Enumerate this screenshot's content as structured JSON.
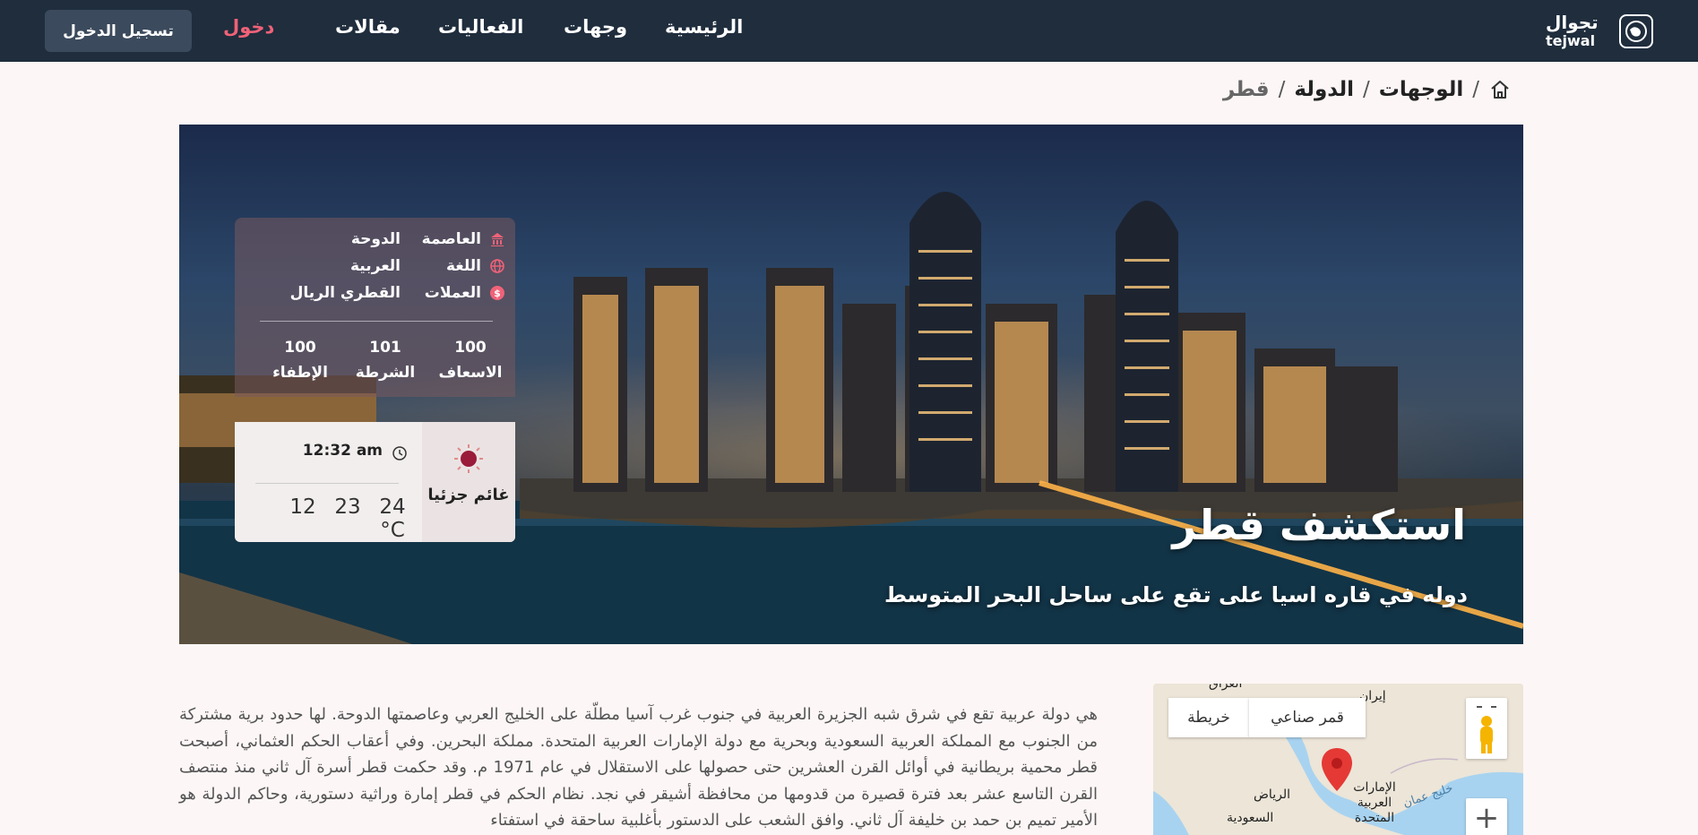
{
  "nav": {
    "logo_text": "تجوال",
    "logo_sub": "tejwal",
    "links": [
      "الرئيسية",
      "وجهات",
      "الفعاليات",
      "مقالات"
    ],
    "login": "دخول",
    "signup": "تسجيل الدخول"
  },
  "breadcrumb": [
    "الوجهات",
    "الدولة",
    "قطر"
  ],
  "hero": {
    "title": "استكشف قطر",
    "subtitle": "دوله في قاره اسيا على تقع على ساحل البحر المتوسط"
  },
  "info": {
    "capital_label": "العاصمة",
    "capital_value": "الدوحة",
    "language_label": "اللغة",
    "language_value": "العربية",
    "currency_label": "العملات",
    "currency_value": "القطري الريال",
    "emergency": [
      {
        "number": "100",
        "label": "الاسعاف"
      },
      {
        "number": "101",
        "label": "الشرطة"
      },
      {
        "number": "100",
        "label": "الإطفاء"
      }
    ]
  },
  "weather": {
    "condition": "غائم جزئيا",
    "time": "12:32 am",
    "temperature": "24 °C",
    "high": "23",
    "low": "12"
  },
  "description": "هي دولة عربية تقع في شرق شبه الجزيرة العربية في جنوب غرب آسيا مطلّة على الخليج العربي وعاصمتها الدوحة. لها حدود برية مشتركة من الجنوب مع المملكة العربية السعودية وبحرية مع دولة الإمارات العربية المتحدة. مملكة البحرين. وفي أعقاب الحكم العثماني، أصبحت قطر محمية بريطانية في أوائل القرن العشرين حتى حصولها على الاستقلال في عام 1971 م. وقد حكمت قطر أسرة آل ثاني منذ منتصف القرن التاسع عشر بعد فترة قصيرة من قدومها من محافظة أشيقر في نجد. نظام الحكم في قطر إمارة وراثية دستورية، وحاكم الدولة هو الأمير تميم بن حمد بن خليفة آل ثاني. وافق الشعب على الدستور بأغلبية ساحقة في استفتاء",
  "map": {
    "btn_satellite": "قمر صناعي",
    "btn_map": "خريطة",
    "labels": {
      "iraq": "العراق",
      "iran": "إيران",
      "riyadh": "الرياض",
      "saudi": "السعودية",
      "uae": "الإمارات العربية المتحدة",
      "gulf_oman": "خليج عمان"
    }
  },
  "colors": {
    "nav_bg": "#1f2d3d",
    "accent": "#f06278",
    "page_bg": "#fdf6f6"
  }
}
